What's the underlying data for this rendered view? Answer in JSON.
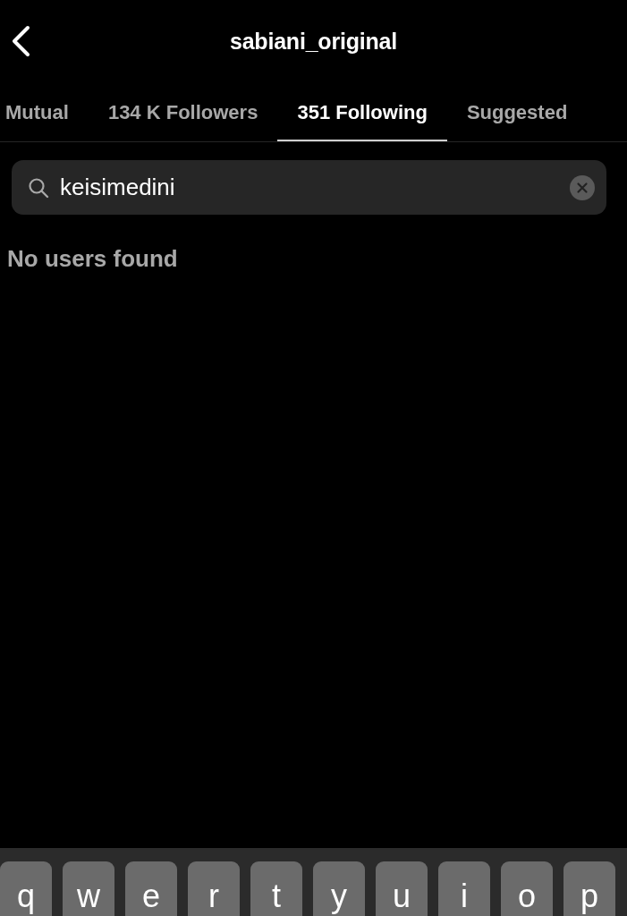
{
  "header": {
    "title": "sabiani_original"
  },
  "tabs": [
    {
      "label": "Mutual",
      "selected": false
    },
    {
      "label": "134 K Followers",
      "selected": false
    },
    {
      "label": "351 Following",
      "selected": true
    },
    {
      "label": "Suggested",
      "selected": false
    }
  ],
  "search": {
    "value": "keisimedini"
  },
  "message": "No users found",
  "keyboard": {
    "keys": [
      "q",
      "w",
      "e",
      "r",
      "t",
      "y",
      "u",
      "i",
      "o",
      "p"
    ]
  }
}
